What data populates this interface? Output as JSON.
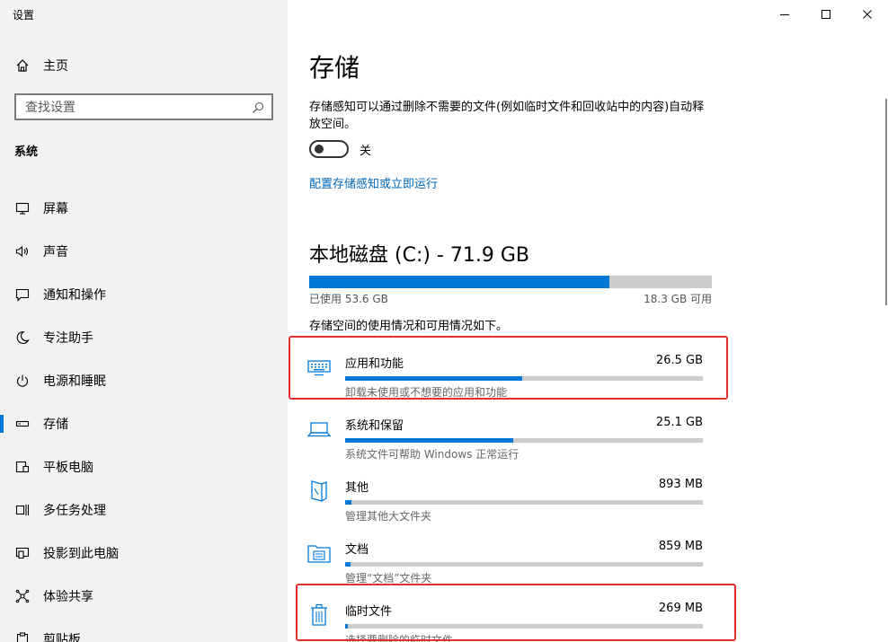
{
  "app": {
    "title": "设置"
  },
  "window_controls": {
    "minimize": "—",
    "maximize": "☐",
    "close": "✕"
  },
  "sidebar": {
    "home": {
      "label": "主页",
      "icon": "home-icon"
    },
    "search": {
      "placeholder": "查找设置",
      "icon": "search-icon"
    },
    "section": "系统",
    "items": [
      {
        "label": "屏幕",
        "icon": "display-icon",
        "selected": false
      },
      {
        "label": "声音",
        "icon": "speaker-icon",
        "selected": false
      },
      {
        "label": "通知和操作",
        "icon": "notification-icon",
        "selected": false
      },
      {
        "label": "专注助手",
        "icon": "moon-icon",
        "selected": false
      },
      {
        "label": "电源和睡眠",
        "icon": "power-icon",
        "selected": false
      },
      {
        "label": "存储",
        "icon": "storage-icon",
        "selected": true
      },
      {
        "label": "平板电脑",
        "icon": "tablet-icon",
        "selected": false
      },
      {
        "label": "多任务处理",
        "icon": "multitask-icon",
        "selected": false
      },
      {
        "label": "投影到此电脑",
        "icon": "project-icon",
        "selected": false
      },
      {
        "label": "体验共享",
        "icon": "share-icon",
        "selected": false
      },
      {
        "label": "剪贴板",
        "icon": "clipboard-icon",
        "selected": false
      }
    ]
  },
  "main": {
    "title": "存储",
    "storage_sense": {
      "description": "存储感知可以通过删除不需要的文件(例如临时文件和回收站中的内容)自动释放空间。",
      "toggle_state": "关",
      "toggle_on": false,
      "configure_link": "配置存储感知或立即运行"
    },
    "disk": {
      "title": "本地磁盘 (C:) - 71.9 GB",
      "used_label": "已使用 53.6 GB",
      "free_label": "18.3 GB 可用",
      "used_fraction": 0.745
    },
    "usage_description": "存储空间的使用情况和可用情况如下。",
    "categories": [
      {
        "name": "应用和功能",
        "size": "26.5 GB",
        "sub": "卸载未使用或不想要的应用和功能",
        "fraction": 0.495,
        "icon": "keyboard-icon",
        "highlighted": true
      },
      {
        "name": "系统和保留",
        "size": "25.1 GB",
        "sub": "系统文件可帮助 Windows 正常运行",
        "fraction": 0.47,
        "icon": "laptop-icon",
        "highlighted": false
      },
      {
        "name": "其他",
        "size": "893 MB",
        "sub": "管理其他大文件夹",
        "fraction": 0.017,
        "icon": "other-files-icon",
        "highlighted": false
      },
      {
        "name": "文档",
        "size": "859 MB",
        "sub": "管理“文档”文件夹",
        "fraction": 0.016,
        "icon": "folder-icon",
        "highlighted": false
      },
      {
        "name": "临时文件",
        "size": "269 MB",
        "sub": "选择要删除的临时文件",
        "fraction": 0.006,
        "icon": "trash-icon",
        "highlighted": true
      }
    ]
  },
  "colors": {
    "accent": "#0078d7",
    "link": "#0067b8",
    "highlight_border": "#e03030",
    "sidebar_bg": "#f2f2f2"
  }
}
